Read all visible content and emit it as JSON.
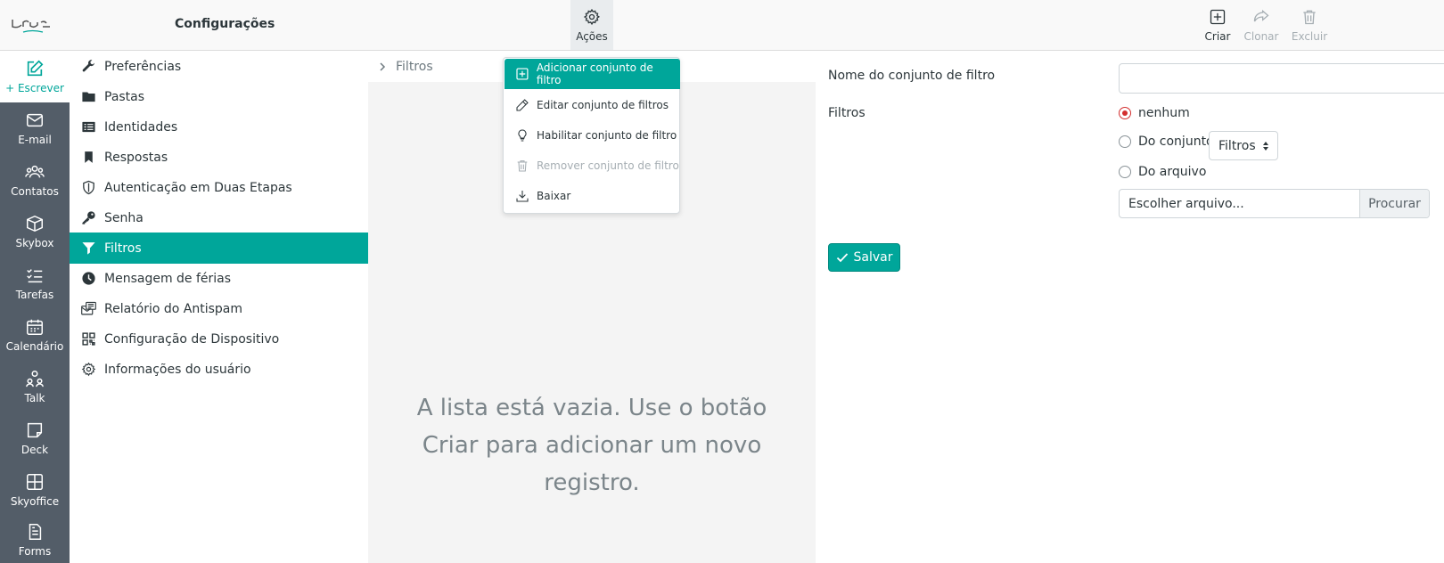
{
  "header": {
    "title": "Configurações",
    "actions_label": "Ações",
    "create_label": "Criar",
    "clone_label": "Clonar",
    "delete_label": "Excluir"
  },
  "nav": {
    "compose_label": "+ Escrever",
    "items": [
      {
        "label": "E-mail",
        "icon": "mail-icon"
      },
      {
        "label": "Contatos",
        "icon": "contacts-icon"
      },
      {
        "label": "Skybox",
        "icon": "box-icon"
      },
      {
        "label": "Tarefas",
        "icon": "tasks-icon"
      },
      {
        "label": "Calendário",
        "icon": "calendar-icon"
      },
      {
        "label": "Talk",
        "icon": "talk-icon"
      },
      {
        "label": "Deck",
        "icon": "deck-icon"
      },
      {
        "label": "Skyoffice",
        "icon": "office-icon"
      },
      {
        "label": "Forms",
        "icon": "forms-icon"
      }
    ]
  },
  "settings": {
    "items": [
      {
        "label": "Preferências",
        "icon": "wrench-icon"
      },
      {
        "label": "Pastas",
        "icon": "folder-icon"
      },
      {
        "label": "Identidades",
        "icon": "id-card-icon"
      },
      {
        "label": "Respostas",
        "icon": "bookmark-icon"
      },
      {
        "label": "Autenticação em Duas Etapas",
        "icon": "shield-icon"
      },
      {
        "label": "Senha",
        "icon": "key-icon"
      },
      {
        "label": "Filtros",
        "icon": "filter-icon"
      },
      {
        "label": "Mensagem de férias",
        "icon": "clock-icon"
      },
      {
        "label": "Relatório do Antispam",
        "icon": "antispam-icon"
      },
      {
        "label": "Configuração de Dispositivo",
        "icon": "qrcode-icon"
      },
      {
        "label": "Informações do usuário",
        "icon": "gear-icon"
      }
    ],
    "selected": "Filtros"
  },
  "list": {
    "breadcrumb": "Filtros",
    "empty_message": "A lista está vazia. Use o botão Criar para adicionar um novo registro."
  },
  "dropdown": {
    "items": [
      {
        "label": "Adicionar conjunto de filtro",
        "icon": "plus-square-icon",
        "state": "active"
      },
      {
        "label": "Editar conjunto de filtros",
        "icon": "pencil-icon",
        "state": "normal"
      },
      {
        "label": "Habilitar conjunto de filtro",
        "icon": "lightbulb-icon",
        "state": "normal"
      },
      {
        "label": "Remover conjunto de filtro",
        "icon": "trash-icon",
        "state": "disabled"
      },
      {
        "label": "Baixar",
        "icon": "download-icon",
        "state": "normal"
      }
    ]
  },
  "form": {
    "name_label": "Nome do conjunto de filtro",
    "name_value": "",
    "filters_label": "Filtros",
    "radio_none": "nenhum",
    "radio_from_set": "Do conjunto",
    "set_select_value": "Filtros",
    "radio_from_file": "Do arquivo",
    "file_placeholder": "Escolher arquivo...",
    "browse_label": "Procurar",
    "save_label": "Salvar",
    "selected_option": "nenhum"
  },
  "colors": {
    "accent": "#00a69a",
    "nav_bg": "#535d68",
    "radio_checked": "#d32f2f"
  }
}
